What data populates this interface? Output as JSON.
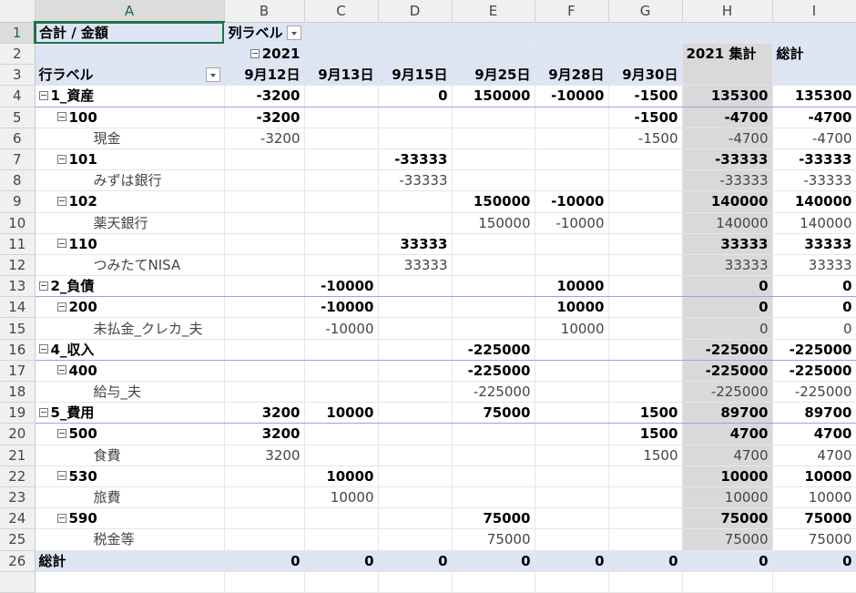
{
  "columns": [
    "A",
    "B",
    "C",
    "D",
    "E",
    "F",
    "G",
    "H",
    "I"
  ],
  "pivot": {
    "value_label": "合計 / 金額",
    "column_label": "列ラベル",
    "row_label": "行ラベル",
    "year": "2021",
    "year_total": "2021 集計",
    "grand_total_col": "総計",
    "dates": [
      "9月12日",
      "9月13日",
      "9月15日",
      "9月25日",
      "9月28日",
      "9月30日"
    ]
  },
  "rows": [
    {
      "n": "4",
      "type": "cat",
      "label": "1_資産",
      "v": [
        "-3200",
        "",
        "0",
        "150000",
        "-10000",
        "-1500",
        "135300",
        "135300"
      ]
    },
    {
      "n": "5",
      "type": "sub",
      "label": "100",
      "v": [
        "-3200",
        "",
        "",
        "",
        "",
        "-1500",
        "-4700",
        "-4700"
      ]
    },
    {
      "n": "6",
      "type": "leaf",
      "label": "現金",
      "v": [
        "-3200",
        "",
        "",
        "",
        "",
        "-1500",
        "-4700",
        "-4700"
      ]
    },
    {
      "n": "7",
      "type": "sub",
      "label": "101",
      "v": [
        "",
        "",
        "-33333",
        "",
        "",
        "",
        "-33333",
        "-33333"
      ]
    },
    {
      "n": "8",
      "type": "leaf",
      "label": "みずは銀行",
      "v": [
        "",
        "",
        "-33333",
        "",
        "",
        "",
        "-33333",
        "-33333"
      ]
    },
    {
      "n": "9",
      "type": "sub",
      "label": "102",
      "v": [
        "",
        "",
        "",
        "150000",
        "-10000",
        "",
        "140000",
        "140000"
      ]
    },
    {
      "n": "10",
      "type": "leaf",
      "label": "薬天銀行",
      "v": [
        "",
        "",
        "",
        "150000",
        "-10000",
        "",
        "140000",
        "140000"
      ]
    },
    {
      "n": "11",
      "type": "sub",
      "label": "110",
      "v": [
        "",
        "",
        "33333",
        "",
        "",
        "",
        "33333",
        "33333"
      ]
    },
    {
      "n": "12",
      "type": "leaf",
      "label": "つみたてNISA",
      "v": [
        "",
        "",
        "33333",
        "",
        "",
        "",
        "33333",
        "33333"
      ]
    },
    {
      "n": "13",
      "type": "cat",
      "label": "2_負債",
      "v": [
        "",
        "-10000",
        "",
        "",
        "10000",
        "",
        "0",
        "0"
      ]
    },
    {
      "n": "14",
      "type": "sub",
      "label": "200",
      "v": [
        "",
        "-10000",
        "",
        "",
        "10000",
        "",
        "0",
        "0"
      ]
    },
    {
      "n": "15",
      "type": "leaf",
      "label": "未払金_クレカ_夫",
      "v": [
        "",
        "-10000",
        "",
        "",
        "10000",
        "",
        "0",
        "0"
      ]
    },
    {
      "n": "16",
      "type": "cat",
      "label": "4_収入",
      "v": [
        "",
        "",
        "",
        "-225000",
        "",
        "",
        "-225000",
        "-225000"
      ]
    },
    {
      "n": "17",
      "type": "sub",
      "label": "400",
      "v": [
        "",
        "",
        "",
        "-225000",
        "",
        "",
        "-225000",
        "-225000"
      ]
    },
    {
      "n": "18",
      "type": "leaf",
      "label": "給与_夫",
      "v": [
        "",
        "",
        "",
        "-225000",
        "",
        "",
        "-225000",
        "-225000"
      ]
    },
    {
      "n": "19",
      "type": "cat",
      "label": "5_費用",
      "v": [
        "3200",
        "10000",
        "",
        "75000",
        "",
        "1500",
        "89700",
        "89700"
      ]
    },
    {
      "n": "20",
      "type": "sub",
      "label": "500",
      "v": [
        "3200",
        "",
        "",
        "",
        "",
        "1500",
        "4700",
        "4700"
      ]
    },
    {
      "n": "21",
      "type": "leaf",
      "label": "食費",
      "v": [
        "3200",
        "",
        "",
        "",
        "",
        "1500",
        "4700",
        "4700"
      ]
    },
    {
      "n": "22",
      "type": "sub",
      "label": "530",
      "v": [
        "",
        "10000",
        "",
        "",
        "",
        "",
        "10000",
        "10000"
      ]
    },
    {
      "n": "23",
      "type": "leaf",
      "label": "旅費",
      "v": [
        "",
        "10000",
        "",
        "",
        "",
        "",
        "10000",
        "10000"
      ]
    },
    {
      "n": "24",
      "type": "sub",
      "label": "590",
      "v": [
        "",
        "",
        "",
        "75000",
        "",
        "",
        "75000",
        "75000"
      ]
    },
    {
      "n": "25",
      "type": "leaf",
      "label": "税金等",
      "v": [
        "",
        "",
        "",
        "75000",
        "",
        "",
        "75000",
        "75000"
      ]
    },
    {
      "n": "26",
      "type": "grand",
      "label": "総計",
      "v": [
        "0",
        "0",
        "0",
        "0",
        "0",
        "0",
        "0",
        "0"
      ]
    }
  ],
  "colors": {
    "header_fill": "#dde5f4",
    "total_fill": "#d9d9d9",
    "selection": "#217346"
  }
}
